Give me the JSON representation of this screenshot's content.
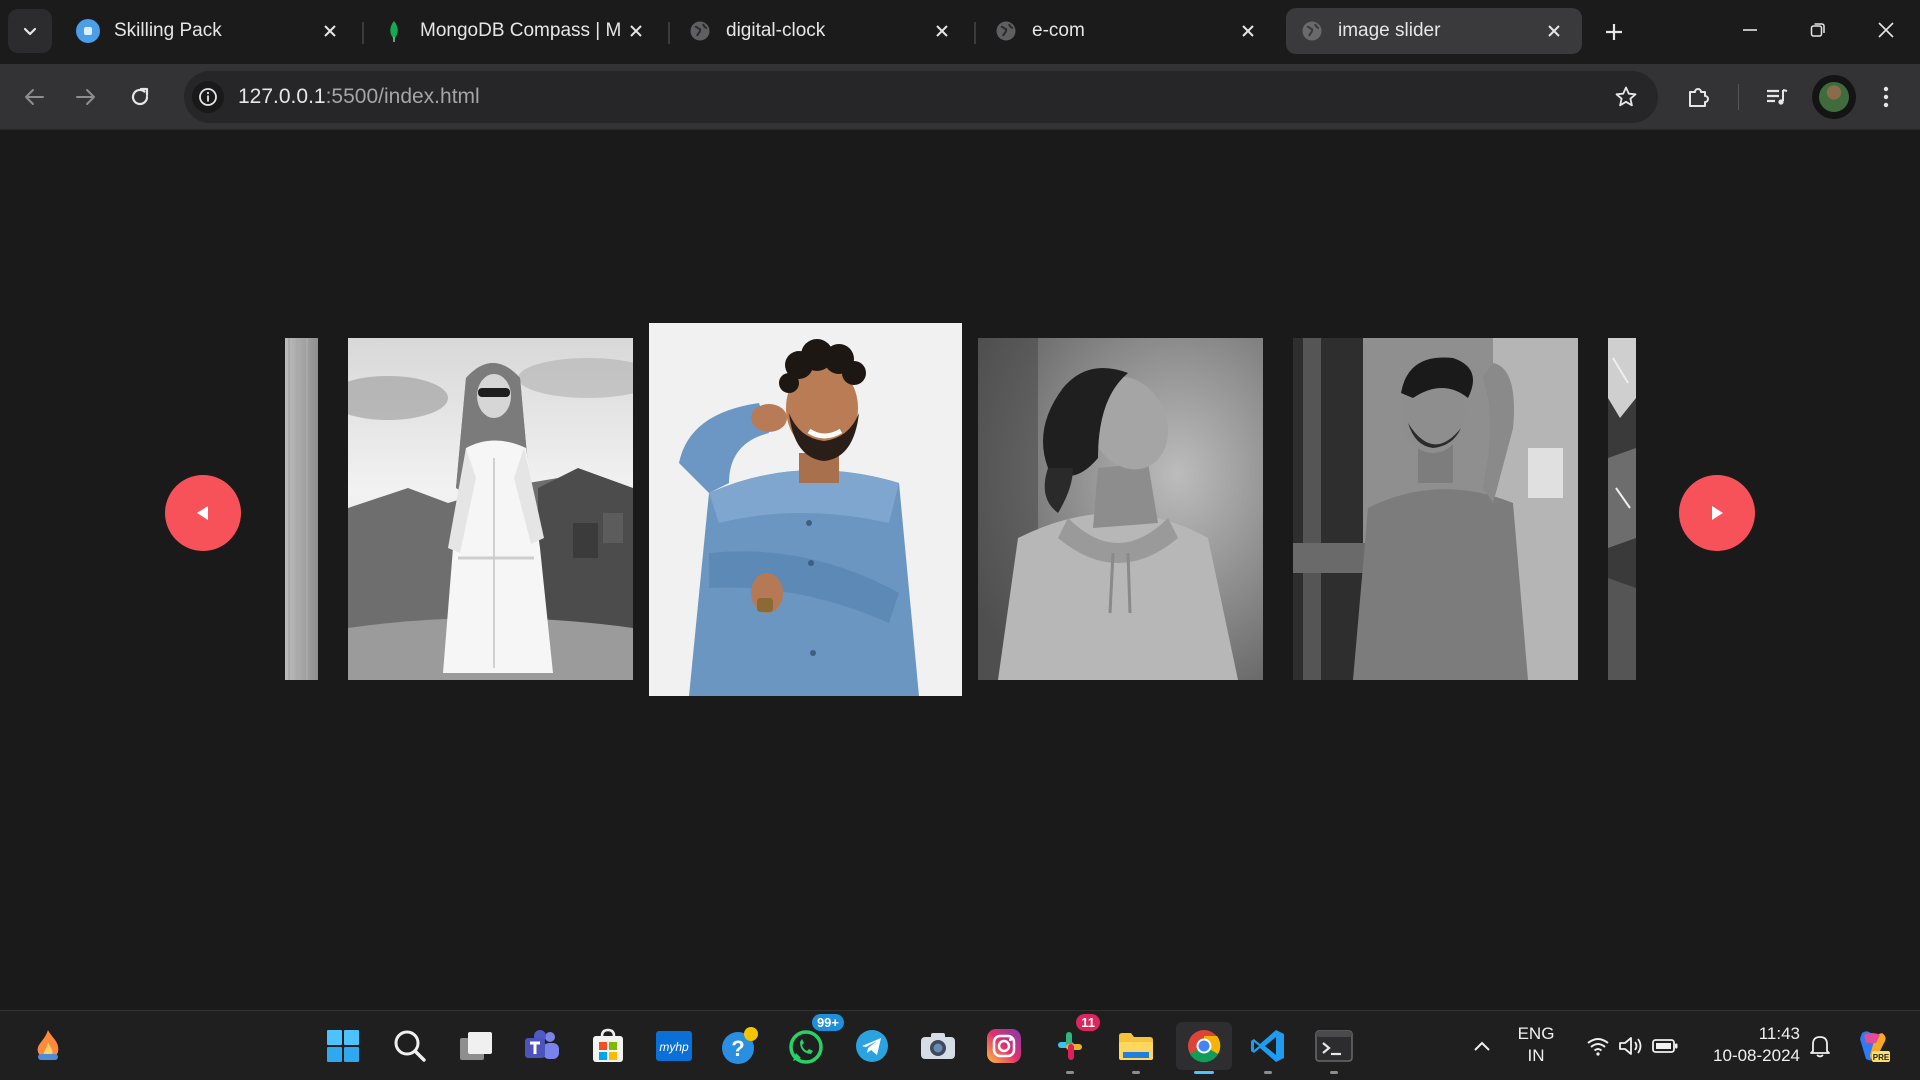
{
  "browser": {
    "tabs": [
      {
        "title": "Skilling Pack",
        "favicon": "skilling-pack-icon",
        "active": false
      },
      {
        "title": "MongoDB Compass | Mo",
        "favicon": "mongodb-leaf-icon",
        "active": false
      },
      {
        "title": "digital-clock",
        "favicon": "globe-icon",
        "active": false
      },
      {
        "title": "e-com",
        "favicon": "globe-icon",
        "active": false
      },
      {
        "title": "image slider",
        "favicon": "globe-icon",
        "active": true
      }
    ],
    "address": {
      "host": "127.0.0.1",
      "path": ":5500/index.html"
    }
  },
  "slider": {
    "accent_color": "#f7525a",
    "slides": [
      {
        "subject": "partial-slide-left"
      },
      {
        "subject": "woman-sunglasses-white-dress"
      },
      {
        "subject": "smiling-man-denim-shirt",
        "active": true
      },
      {
        "subject": "man-curly-hair-hoodie"
      },
      {
        "subject": "man-tshirt-hand-in-hair"
      },
      {
        "subject": "partial-slide-right"
      }
    ]
  },
  "taskbar": {
    "whatsapp_badge": "99+",
    "slack_badge": "11",
    "language": {
      "line1": "ENG",
      "line2": "IN"
    },
    "clock": {
      "time": "11:43",
      "date": "10-08-2024"
    },
    "copilot_badge": "PRE"
  }
}
